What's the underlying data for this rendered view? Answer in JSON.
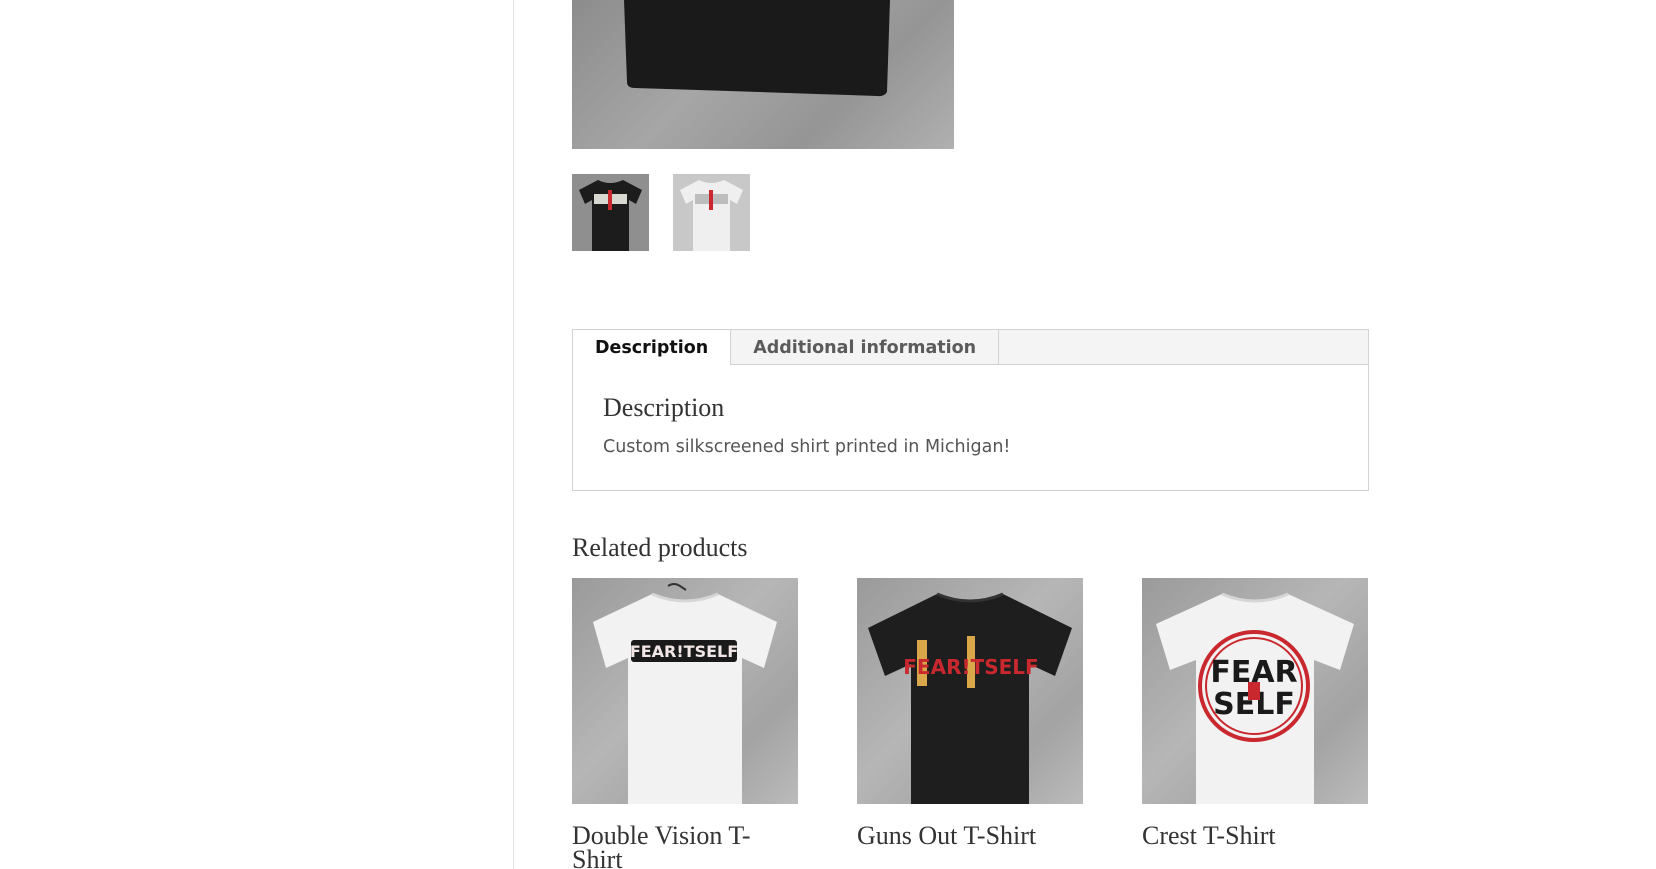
{
  "gallery": {
    "main_alt": "FEAR!TSELF black t-shirt",
    "thumbnails": [
      {
        "name": "black shirt thumbnail",
        "shirt_color": "#1c1c1c"
      },
      {
        "name": "white shirt thumbnail",
        "shirt_color": "#efefef"
      }
    ]
  },
  "tabs": {
    "items": [
      {
        "label": "Description",
        "active": true
      },
      {
        "label": "Additional information",
        "active": false
      }
    ],
    "panel": {
      "heading": "Description",
      "text": "Custom silkscreened shirt printed in Michigan!"
    }
  },
  "related": {
    "heading": "Related products",
    "products": [
      {
        "name": "Double Vision T-Shirt",
        "shirt_color": "#f2f2f2",
        "print_text": "FEAR!TSELF"
      },
      {
        "name": "Guns Out T-Shirt",
        "shirt_color": "#1e1e1e",
        "print_text": "FEAR!TSELF"
      },
      {
        "name": "Crest T-Shirt",
        "shirt_color": "#f2f2f2",
        "print_text": "FEAR !T SELF"
      }
    ]
  },
  "colors": {
    "border": "#d3d3d3",
    "tab_bar_bg": "#f4f4f4",
    "accent_red": "#c8282e"
  }
}
